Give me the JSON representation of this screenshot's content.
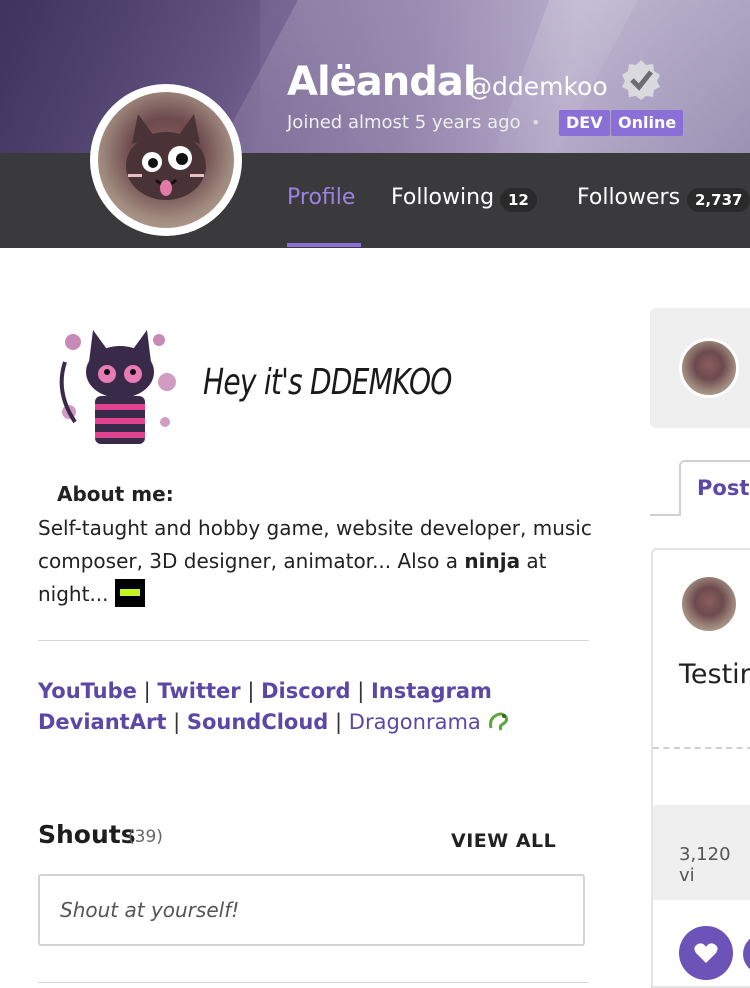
{
  "profile": {
    "display_name": "Alëandal",
    "handle": "@ddemkoo",
    "joined": "Joined almost 5 years ago",
    "separator": "•",
    "badges": [
      "DEV",
      "Online"
    ]
  },
  "tabs": {
    "profile_label": "Profile",
    "following_label": "Following",
    "following_count": "12",
    "followers_label": "Followers",
    "followers_count": "2,737"
  },
  "about": {
    "banner_text": "Hey it's DDEMKOO",
    "title": "About me:",
    "line_prefix": "Self-taught and hobby game, website developer, music composer, 3D designer, animator... Also a ",
    "ninja_word": "ninja",
    "line_suffix": " at night..."
  },
  "links": {
    "items": [
      "YouTube",
      "Twitter",
      "Discord",
      "Instagram",
      "DeviantArt",
      "SoundCloud",
      "Dragonrama"
    ],
    "separator": "|"
  },
  "shouts": {
    "title": "Shouts",
    "count": "(39)",
    "view_all": "VIEW ALL",
    "placeholder": "Shout at yourself!"
  },
  "right": {
    "posts_tab": "Posts",
    "post_title": "Testin",
    "views": "3,120 vi"
  },
  "colors": {
    "accent": "#8a6fd6",
    "link": "#5b48a6",
    "navbar": "#3a3a3c"
  }
}
